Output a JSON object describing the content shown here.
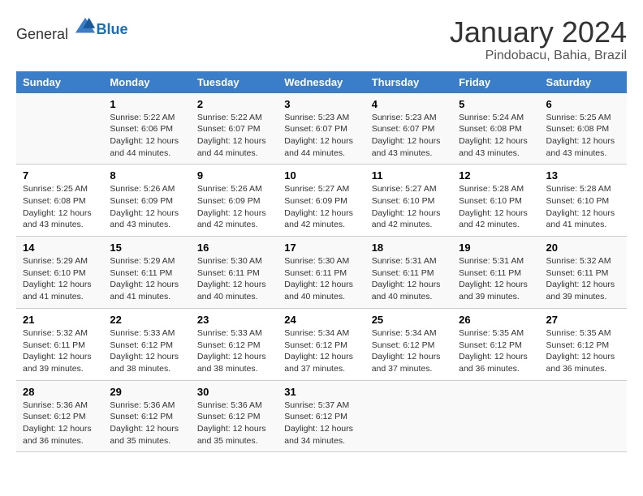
{
  "header": {
    "logo": {
      "general": "General",
      "blue": "Blue"
    },
    "title": "January 2024",
    "location": "Pindobacu, Bahia, Brazil"
  },
  "weekdays": [
    "Sunday",
    "Monday",
    "Tuesday",
    "Wednesday",
    "Thursday",
    "Friday",
    "Saturday"
  ],
  "weeks": [
    [
      {
        "day": "",
        "info": ""
      },
      {
        "day": "1",
        "info": "Sunrise: 5:22 AM\nSunset: 6:06 PM\nDaylight: 12 hours\nand 44 minutes."
      },
      {
        "day": "2",
        "info": "Sunrise: 5:22 AM\nSunset: 6:07 PM\nDaylight: 12 hours\nand 44 minutes."
      },
      {
        "day": "3",
        "info": "Sunrise: 5:23 AM\nSunset: 6:07 PM\nDaylight: 12 hours\nand 44 minutes."
      },
      {
        "day": "4",
        "info": "Sunrise: 5:23 AM\nSunset: 6:07 PM\nDaylight: 12 hours\nand 43 minutes."
      },
      {
        "day": "5",
        "info": "Sunrise: 5:24 AM\nSunset: 6:08 PM\nDaylight: 12 hours\nand 43 minutes."
      },
      {
        "day": "6",
        "info": "Sunrise: 5:25 AM\nSunset: 6:08 PM\nDaylight: 12 hours\nand 43 minutes."
      }
    ],
    [
      {
        "day": "7",
        "info": "Sunrise: 5:25 AM\nSunset: 6:08 PM\nDaylight: 12 hours\nand 43 minutes."
      },
      {
        "day": "8",
        "info": "Sunrise: 5:26 AM\nSunset: 6:09 PM\nDaylight: 12 hours\nand 43 minutes."
      },
      {
        "day": "9",
        "info": "Sunrise: 5:26 AM\nSunset: 6:09 PM\nDaylight: 12 hours\nand 42 minutes."
      },
      {
        "day": "10",
        "info": "Sunrise: 5:27 AM\nSunset: 6:09 PM\nDaylight: 12 hours\nand 42 minutes."
      },
      {
        "day": "11",
        "info": "Sunrise: 5:27 AM\nSunset: 6:10 PM\nDaylight: 12 hours\nand 42 minutes."
      },
      {
        "day": "12",
        "info": "Sunrise: 5:28 AM\nSunset: 6:10 PM\nDaylight: 12 hours\nand 42 minutes."
      },
      {
        "day": "13",
        "info": "Sunrise: 5:28 AM\nSunset: 6:10 PM\nDaylight: 12 hours\nand 41 minutes."
      }
    ],
    [
      {
        "day": "14",
        "info": "Sunrise: 5:29 AM\nSunset: 6:10 PM\nDaylight: 12 hours\nand 41 minutes."
      },
      {
        "day": "15",
        "info": "Sunrise: 5:29 AM\nSunset: 6:11 PM\nDaylight: 12 hours\nand 41 minutes."
      },
      {
        "day": "16",
        "info": "Sunrise: 5:30 AM\nSunset: 6:11 PM\nDaylight: 12 hours\nand 40 minutes."
      },
      {
        "day": "17",
        "info": "Sunrise: 5:30 AM\nSunset: 6:11 PM\nDaylight: 12 hours\nand 40 minutes."
      },
      {
        "day": "18",
        "info": "Sunrise: 5:31 AM\nSunset: 6:11 PM\nDaylight: 12 hours\nand 40 minutes."
      },
      {
        "day": "19",
        "info": "Sunrise: 5:31 AM\nSunset: 6:11 PM\nDaylight: 12 hours\nand 39 minutes."
      },
      {
        "day": "20",
        "info": "Sunrise: 5:32 AM\nSunset: 6:11 PM\nDaylight: 12 hours\nand 39 minutes."
      }
    ],
    [
      {
        "day": "21",
        "info": "Sunrise: 5:32 AM\nSunset: 6:11 PM\nDaylight: 12 hours\nand 39 minutes."
      },
      {
        "day": "22",
        "info": "Sunrise: 5:33 AM\nSunset: 6:12 PM\nDaylight: 12 hours\nand 38 minutes."
      },
      {
        "day": "23",
        "info": "Sunrise: 5:33 AM\nSunset: 6:12 PM\nDaylight: 12 hours\nand 38 minutes."
      },
      {
        "day": "24",
        "info": "Sunrise: 5:34 AM\nSunset: 6:12 PM\nDaylight: 12 hours\nand 37 minutes."
      },
      {
        "day": "25",
        "info": "Sunrise: 5:34 AM\nSunset: 6:12 PM\nDaylight: 12 hours\nand 37 minutes."
      },
      {
        "day": "26",
        "info": "Sunrise: 5:35 AM\nSunset: 6:12 PM\nDaylight: 12 hours\nand 36 minutes."
      },
      {
        "day": "27",
        "info": "Sunrise: 5:35 AM\nSunset: 6:12 PM\nDaylight: 12 hours\nand 36 minutes."
      }
    ],
    [
      {
        "day": "28",
        "info": "Sunrise: 5:36 AM\nSunset: 6:12 PM\nDaylight: 12 hours\nand 36 minutes."
      },
      {
        "day": "29",
        "info": "Sunrise: 5:36 AM\nSunset: 6:12 PM\nDaylight: 12 hours\nand 35 minutes."
      },
      {
        "day": "30",
        "info": "Sunrise: 5:36 AM\nSunset: 6:12 PM\nDaylight: 12 hours\nand 35 minutes."
      },
      {
        "day": "31",
        "info": "Sunrise: 5:37 AM\nSunset: 6:12 PM\nDaylight: 12 hours\nand 34 minutes."
      },
      {
        "day": "",
        "info": ""
      },
      {
        "day": "",
        "info": ""
      },
      {
        "day": "",
        "info": ""
      }
    ]
  ]
}
